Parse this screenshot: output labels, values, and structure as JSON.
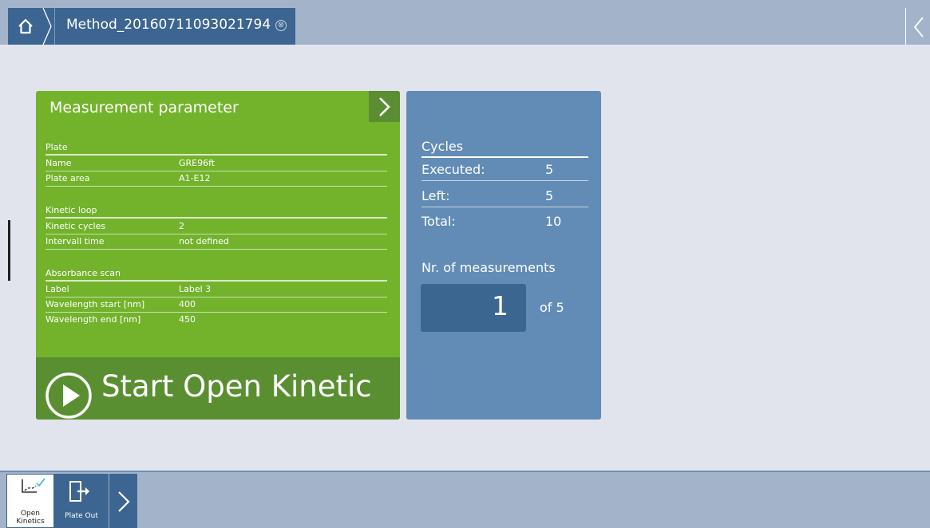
{
  "tab": {
    "title": "Method_20160711093021794",
    "close_glyph": "⊗"
  },
  "icons": {
    "home": "home-icon",
    "back": "chevron-left-icon",
    "next": "chevron-right-icon",
    "play": "play-circle-icon",
    "open_kinetics": "kinetics-chart-icon",
    "plate_out": "plate-out-icon"
  },
  "colors": {
    "accent_blue": "#3c6592",
    "param_green": "#73b32c",
    "start_green": "#5a8f31",
    "cycles_blue": "#628cb5",
    "check_cyan": "#47b8e8"
  },
  "params": {
    "title": "Measurement parameter",
    "sections": [
      {
        "title": "Plate",
        "rows": [
          {
            "label": "Name",
            "value": "GRE96ft"
          },
          {
            "label": "Plate area",
            "value": "A1-E12"
          }
        ]
      },
      {
        "title": "Kinetic loop",
        "rows": [
          {
            "label": "Kinetic cycles",
            "value": "2"
          },
          {
            "label": "Intervall time",
            "value": "not defined"
          }
        ]
      },
      {
        "title": "Absorbance scan",
        "rows": [
          {
            "label": "Label",
            "value": "Label 3"
          },
          {
            "label": "Wavelength start [nm]",
            "value": "400"
          },
          {
            "label": "Wavelength end [nm]",
            "value": "450"
          }
        ]
      }
    ],
    "start_label": "Start Open Kinetic"
  },
  "cycles": {
    "title": "Cycles",
    "rows": [
      {
        "label": "Executed:",
        "value": "5"
      },
      {
        "label": "Left:",
        "value": "5"
      },
      {
        "label": "Total:",
        "value": "10"
      }
    ],
    "measurements_label": "Nr. of measurements",
    "measurements_value": "1",
    "measurements_of": "of 5"
  },
  "toolbar": {
    "open_kinetics_label": "Open Kinetics",
    "plate_out_label": "Plate Out"
  }
}
